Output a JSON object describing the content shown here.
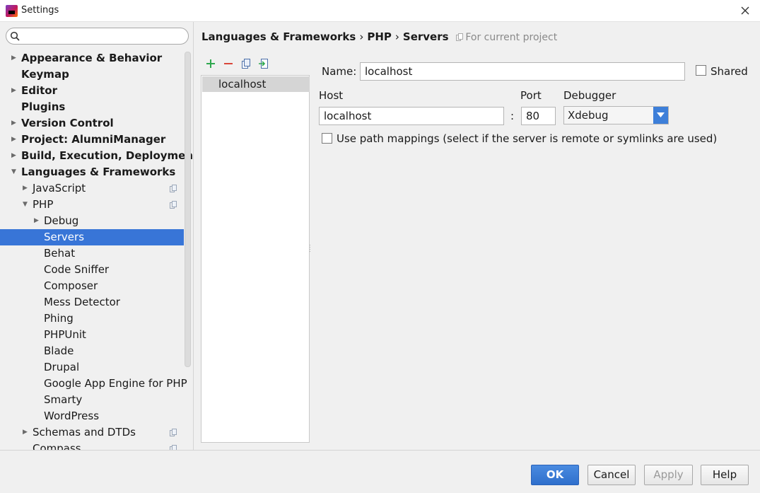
{
  "window": {
    "title": "Settings"
  },
  "search": {
    "placeholder": ""
  },
  "sidebar": {
    "items": [
      {
        "label": "Appearance & Behavior",
        "bold": true,
        "indent": 0,
        "arrow": "right"
      },
      {
        "label": "Keymap",
        "bold": true,
        "indent": 0,
        "arrow": ""
      },
      {
        "label": "Editor",
        "bold": true,
        "indent": 0,
        "arrow": "right"
      },
      {
        "label": "Plugins",
        "bold": true,
        "indent": 0,
        "arrow": ""
      },
      {
        "label": "Version Control",
        "bold": true,
        "indent": 0,
        "arrow": "right"
      },
      {
        "label": "Project: AlumniManager",
        "bold": true,
        "indent": 0,
        "arrow": "right"
      },
      {
        "label": "Build, Execution, Deployment",
        "bold": true,
        "indent": 0,
        "arrow": "right"
      },
      {
        "label": "Languages & Frameworks",
        "bold": true,
        "indent": 0,
        "arrow": "down"
      },
      {
        "label": "JavaScript",
        "bold": false,
        "indent": 1,
        "arrow": "right",
        "project": true
      },
      {
        "label": "PHP",
        "bold": false,
        "indent": 1,
        "arrow": "down",
        "project": true
      },
      {
        "label": "Debug",
        "bold": false,
        "indent": 2,
        "arrow": "right"
      },
      {
        "label": "Servers",
        "bold": false,
        "indent": 2,
        "arrow": "",
        "selected": true
      },
      {
        "label": "Behat",
        "bold": false,
        "indent": 2,
        "arrow": ""
      },
      {
        "label": "Code Sniffer",
        "bold": false,
        "indent": 2,
        "arrow": ""
      },
      {
        "label": "Composer",
        "bold": false,
        "indent": 2,
        "arrow": ""
      },
      {
        "label": "Mess Detector",
        "bold": false,
        "indent": 2,
        "arrow": ""
      },
      {
        "label": "Phing",
        "bold": false,
        "indent": 2,
        "arrow": ""
      },
      {
        "label": "PHPUnit",
        "bold": false,
        "indent": 2,
        "arrow": ""
      },
      {
        "label": "Blade",
        "bold": false,
        "indent": 2,
        "arrow": ""
      },
      {
        "label": "Drupal",
        "bold": false,
        "indent": 2,
        "arrow": ""
      },
      {
        "label": "Google App Engine for PHP",
        "bold": false,
        "indent": 2,
        "arrow": ""
      },
      {
        "label": "Smarty",
        "bold": false,
        "indent": 2,
        "arrow": ""
      },
      {
        "label": "WordPress",
        "bold": false,
        "indent": 2,
        "arrow": ""
      },
      {
        "label": "Schemas and DTDs",
        "bold": false,
        "indent": 1,
        "arrow": "right",
        "project": true
      },
      {
        "label": "Compass",
        "bold": false,
        "indent": 1,
        "arrow": "",
        "project": true
      }
    ]
  },
  "breadcrumb": {
    "parts": [
      "Languages & Frameworks",
      "PHP",
      "Servers"
    ],
    "separator": "›",
    "scope": "For current project"
  },
  "servers": {
    "items": [
      "localhost"
    ]
  },
  "form": {
    "name_label": "Name:",
    "name_value": "localhost",
    "shared_label": "Shared",
    "host_label": "Host",
    "host_value": "localhost",
    "colon": ":",
    "port_label": "Port",
    "port_value": "80",
    "debugger_label": "Debugger",
    "debugger_value": "Xdebug",
    "path_mappings_label": "Use path mappings (select if the server is remote or symlinks are used)"
  },
  "buttons": {
    "ok": "OK",
    "cancel": "Cancel",
    "apply": "Apply",
    "help": "Help"
  },
  "colors": {
    "accent": "#3875d7",
    "add": "#2fa84f",
    "remove": "#d9463a"
  }
}
